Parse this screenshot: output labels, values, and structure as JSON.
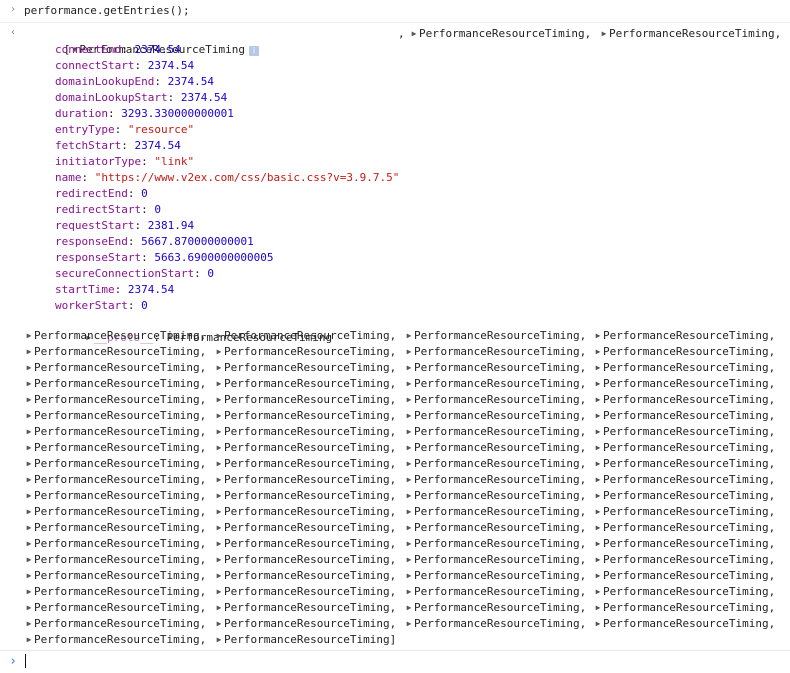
{
  "console": {
    "command": "performance.getEntries();",
    "result": {
      "open_bracket": "[",
      "first_entry_label": "PerformanceResourceTiming",
      "info_badge": "i",
      "header_tail_1": "PerformanceResourceTiming,",
      "header_tail_2": "PerformanceResourceTiming,",
      "properties": [
        {
          "key": "connectEnd",
          "value": "2374.54",
          "kind": "num"
        },
        {
          "key": "connectStart",
          "value": "2374.54",
          "kind": "num"
        },
        {
          "key": "domainLookupEnd",
          "value": "2374.54",
          "kind": "num"
        },
        {
          "key": "domainLookupStart",
          "value": "2374.54",
          "kind": "num"
        },
        {
          "key": "duration",
          "value": "3293.330000000001",
          "kind": "num"
        },
        {
          "key": "entryType",
          "value": "\"resource\"",
          "kind": "str"
        },
        {
          "key": "fetchStart",
          "value": "2374.54",
          "kind": "num"
        },
        {
          "key": "initiatorType",
          "value": "\"link\"",
          "kind": "str"
        },
        {
          "key": "name",
          "value": "\"https://www.v2ex.com/css/basic.css?v=3.9.7.5\"",
          "kind": "str"
        },
        {
          "key": "redirectEnd",
          "value": "0",
          "kind": "num"
        },
        {
          "key": "redirectStart",
          "value": "0",
          "kind": "num"
        },
        {
          "key": "requestStart",
          "value": "2381.94",
          "kind": "num"
        },
        {
          "key": "responseEnd",
          "value": "5667.870000000001",
          "kind": "num"
        },
        {
          "key": "responseStart",
          "value": "5663.6900000000005",
          "kind": "num"
        },
        {
          "key": "secureConnectionStart",
          "value": "0",
          "kind": "num"
        },
        {
          "key": "startTime",
          "value": "2374.54",
          "kind": "num"
        },
        {
          "key": "workerStart",
          "value": "0",
          "kind": "num"
        }
      ],
      "proto": {
        "key": "__proto__",
        "value": "PerformanceResourceTiming"
      },
      "entry_label": "PerformanceResourceTiming,",
      "last_entry_label": "PerformanceResourceTiming]",
      "entry_rows": 20
    }
  }
}
